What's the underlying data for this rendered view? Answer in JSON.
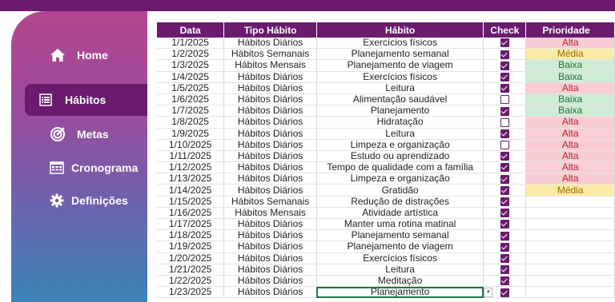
{
  "sidebar": {
    "items": [
      {
        "label": "Home",
        "icon": "home-icon"
      },
      {
        "label": "Hábitos",
        "icon": "list-icon",
        "active": true
      },
      {
        "label": "Metas",
        "icon": "target-icon"
      },
      {
        "label": "Cronograma",
        "icon": "calendar-icon"
      },
      {
        "label": "Definições",
        "icon": "gear-icon"
      }
    ]
  },
  "table": {
    "headers": [
      "Data",
      "Tipo Hábito",
      "Hábito",
      "Check",
      "Prioridade"
    ],
    "rows": [
      {
        "data": "1/1/2025",
        "tipo": "Hábitos Diários",
        "habito": "Exercícios físicos",
        "check": true,
        "prioridade": "Alta"
      },
      {
        "data": "1/2/2025",
        "tipo": "Hábitos Semanais",
        "habito": "Planejamento semanal",
        "check": true,
        "prioridade": "Média"
      },
      {
        "data": "1/3/2025",
        "tipo": "Hábitos Mensais",
        "habito": "Planejamento de viagem",
        "check": true,
        "prioridade": "Baixa"
      },
      {
        "data": "1/4/2025",
        "tipo": "Hábitos Diários",
        "habito": "Exercícios físicos",
        "check": true,
        "prioridade": "Baixa"
      },
      {
        "data": "1/5/2025",
        "tipo": "Hábitos Diários",
        "habito": "Leitura",
        "check": true,
        "prioridade": "Alta"
      },
      {
        "data": "1/6/2025",
        "tipo": "Hábitos Diários",
        "habito": "Alimentação saudável",
        "check": false,
        "prioridade": "Baixa"
      },
      {
        "data": "1/7/2025",
        "tipo": "Hábitos Diários",
        "habito": "Planejamento",
        "check": true,
        "prioridade": "Baixa"
      },
      {
        "data": "1/8/2025",
        "tipo": "Hábitos Diários",
        "habito": "Hidratação",
        "check": false,
        "prioridade": "Alta"
      },
      {
        "data": "1/9/2025",
        "tipo": "Hábitos Diários",
        "habito": "Leitura",
        "check": true,
        "prioridade": "Alta"
      },
      {
        "data": "1/10/2025",
        "tipo": "Hábitos Diários",
        "habito": "Limpeza e organização",
        "check": false,
        "prioridade": "Alta"
      },
      {
        "data": "1/11/2025",
        "tipo": "Hábitos Diários",
        "habito": "Estudo ou aprendizado",
        "check": true,
        "prioridade": "Alta"
      },
      {
        "data": "1/12/2025",
        "tipo": "Hábitos Diários",
        "habito": "Tempo de qualidade com a família",
        "check": true,
        "prioridade": "Alta"
      },
      {
        "data": "1/13/2025",
        "tipo": "Hábitos Diários",
        "habito": "Limpeza e organização",
        "check": true,
        "prioridade": "Alta"
      },
      {
        "data": "1/14/2025",
        "tipo": "Hábitos Diários",
        "habito": "Gratidão",
        "check": true,
        "prioridade": "Média"
      },
      {
        "data": "1/15/2025",
        "tipo": "Hábitos Semanais",
        "habito": "Redução de distrações",
        "check": true,
        "prioridade": ""
      },
      {
        "data": "1/16/2025",
        "tipo": "Hábitos Mensais",
        "habito": "Atividade artística",
        "check": true,
        "prioridade": ""
      },
      {
        "data": "1/17/2025",
        "tipo": "Hábitos Diários",
        "habito": "Manter uma rotina matinal",
        "check": true,
        "prioridade": ""
      },
      {
        "data": "1/18/2025",
        "tipo": "Hábitos Diários",
        "habito": "Planejamento semanal",
        "check": true,
        "prioridade": ""
      },
      {
        "data": "1/19/2025",
        "tipo": "Hábitos Diários",
        "habito": "Planejamento de viagem",
        "check": true,
        "prioridade": ""
      },
      {
        "data": "1/20/2025",
        "tipo": "Hábitos Diários",
        "habito": "Exercícios físicos",
        "check": true,
        "prioridade": ""
      },
      {
        "data": "1/21/2025",
        "tipo": "Hábitos Diários",
        "habito": "Leitura",
        "check": true,
        "prioridade": ""
      },
      {
        "data": "1/22/2025",
        "tipo": "Hábitos Diários",
        "habito": "Meditação",
        "check": true,
        "prioridade": ""
      },
      {
        "data": "1/23/2025",
        "tipo": "Hábitos Diários",
        "habito": "Planejamento",
        "check": true,
        "prioridade": "",
        "selected": true
      }
    ]
  },
  "colors": {
    "header_bg": "#6a1b6e",
    "alta_bg": "#f9cdd3",
    "media_bg": "#fbeba6",
    "baixa_bg": "#cfecd4"
  }
}
